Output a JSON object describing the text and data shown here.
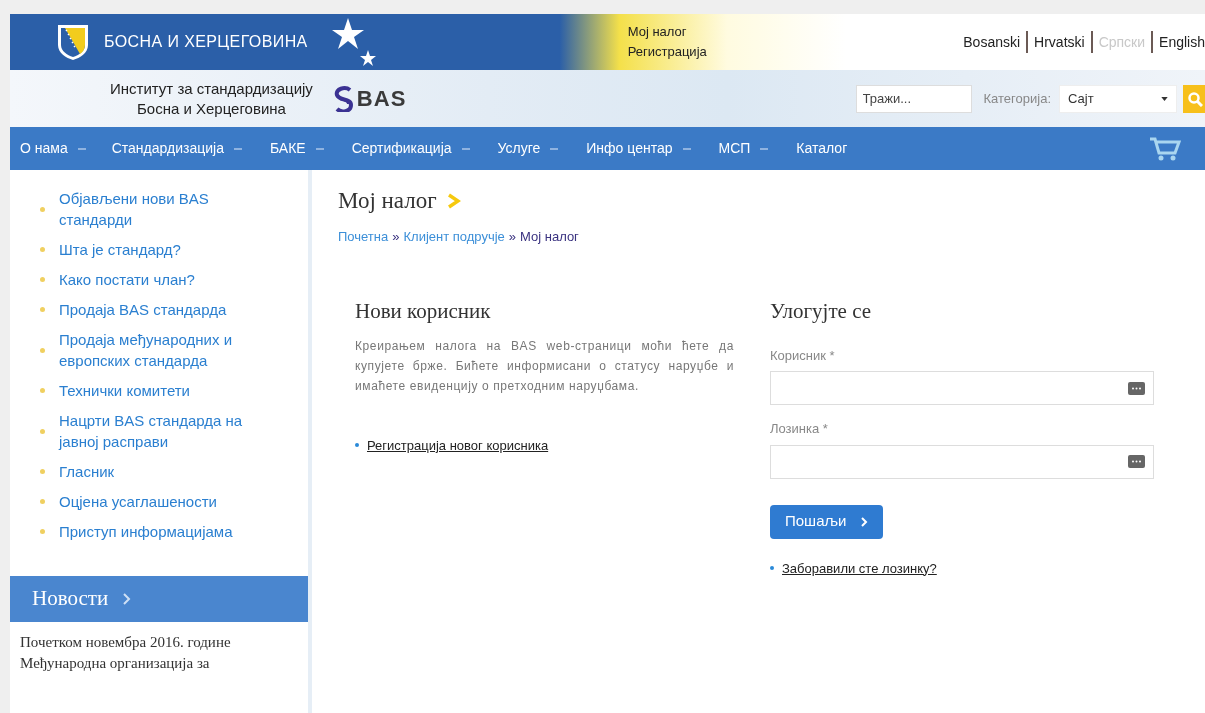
{
  "header": {
    "country": "БОСНА И ХЕРЦЕГОВИНА",
    "institute_lines": [
      "Институт за стандардизацију",
      "Босна и Херцеговина"
    ],
    "logo_text": "BAS",
    "account_links": [
      "Мој налог",
      "Регистрација"
    ],
    "languages": [
      {
        "label": "Bosanski",
        "selected": false
      },
      {
        "label": "Hrvatski",
        "selected": false
      },
      {
        "label": "Српски",
        "selected": true
      },
      {
        "label": "English",
        "selected": false
      }
    ],
    "search": {
      "placeholder": "Тражи..."
    },
    "category": {
      "label": "Категорија:",
      "value": "Сајт"
    }
  },
  "nav": [
    {
      "label": "О нама",
      "dropdown": true
    },
    {
      "label": "Стандардизација",
      "dropdown": true
    },
    {
      "label": "БАКЕ",
      "dropdown": true
    },
    {
      "label": "Сертификација",
      "dropdown": true
    },
    {
      "label": "Услуге",
      "dropdown": true
    },
    {
      "label": "Инфо центар",
      "dropdown": true
    },
    {
      "label": "МСП",
      "dropdown": true
    },
    {
      "label": "Каталог",
      "dropdown": false
    }
  ],
  "sidebar": {
    "links": [
      "Објављени нови BAS стандарди",
      "Шта је стандард?",
      "Како постати члан?",
      "Продаја BAS стандарда",
      "Продаја међународних и европских стандарда",
      "Технички комитети",
      "Нацрти BAS стандарда на јавној расправи",
      "Гласник",
      "Оцјена усаглашености",
      "Приступ информацијама"
    ],
    "news": {
      "title": "Новости",
      "text": "Почетком новембра 2016. године Међународна организација за"
    }
  },
  "main": {
    "title": "Мој налог",
    "breadcrumb": [
      {
        "label": "Почетна",
        "current": false
      },
      {
        "label": "Клијент подручје",
        "current": false
      },
      {
        "label": "Мој налог",
        "current": true
      }
    ],
    "separator": "»",
    "new_user": {
      "title": "Нови корисник",
      "text": "Креирањем налога на BAS web-страници моћи ћете да купујете брже. Бићете информисани о статусу наруџбе и имаћете евиденцију о претходним наруџбама.",
      "link": "Регистрација новог корисника"
    },
    "login": {
      "title": "Улогујте се",
      "fields": [
        {
          "label": "Корисник *"
        },
        {
          "label": "Лозинка *"
        }
      ],
      "submit": "Пошаљи",
      "link": "Заборавили сте лозинку?"
    }
  }
}
